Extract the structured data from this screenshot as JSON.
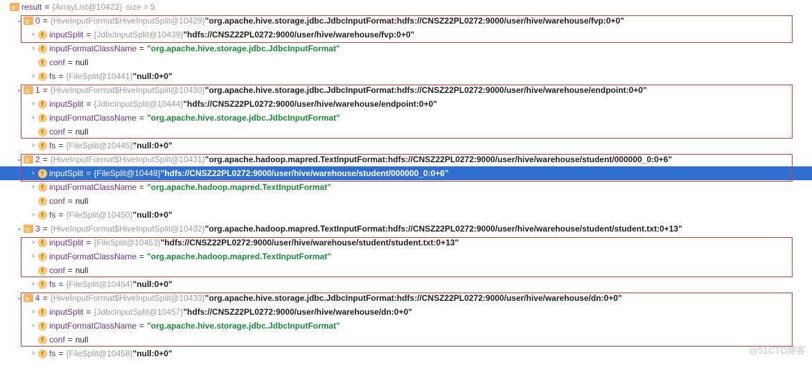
{
  "root": {
    "name": "result",
    "type": "{ArrayList@10422}",
    "size_label": "size = 5"
  },
  "items": [
    {
      "idx": "0",
      "type": "{HiveInputFormat$HiveInputSplit@10429}",
      "text": "\"org.apache.hive.storage.jdbc.JdbcInputFormat:hdfs://CNSZ22PL0272:9000/user/hive/warehouse/fvp:0+0\"",
      "inputSplit_type": "{JdbcInputSplit@10439}",
      "inputSplit_text": "\"hdfs://CNSZ22PL0272:9000/user/hive/warehouse/fvp:0+0\"",
      "inputFormatClassName": "\"org.apache.hive.storage.jdbc.JdbcInputFormat\"",
      "conf": "null",
      "fs_type": "{FileSplit@10441}",
      "fs_text": "\"null:0+0\""
    },
    {
      "idx": "1",
      "type": "{HiveInputFormat$HiveInputSplit@10430}",
      "text": "\"org.apache.hive.storage.jdbc.JdbcInputFormat:hdfs://CNSZ22PL0272:9000/user/hive/warehouse/endpoint:0+0\"",
      "inputSplit_type": "{JdbcInputSplit@10444}",
      "inputSplit_text": "\"hdfs://CNSZ22PL0272:9000/user/hive/warehouse/endpoint:0+0\"",
      "inputFormatClassName": "\"org.apache.hive.storage.jdbc.JdbcInputFormat\"",
      "conf": "null",
      "fs_type": "{FileSplit@10445}",
      "fs_text": "\"null:0+0\""
    },
    {
      "idx": "2",
      "type": "{HiveInputFormat$HiveInputSplit@10431}",
      "text": "\"org.apache.hadoop.mapred.TextInputFormat:hdfs://CNSZ22PL0272:9000/user/hive/warehouse/student/000000_0:0+6\"",
      "inputSplit_type": "{FileSplit@10448}",
      "inputSplit_text": "\"hdfs://CNSZ22PL0272:9000/user/hive/warehouse/student/000000_0:0+6\"",
      "inputFormatClassName": "\"org.apache.hadoop.mapred.TextInputFormat\"",
      "conf": "null",
      "fs_type": "{FileSplit@10450}",
      "fs_text": "\"null:0+0\""
    },
    {
      "idx": "3",
      "type": "{HiveInputFormat$HiveInputSplit@10432}",
      "text": "\"org.apache.hadoop.mapred.TextInputFormat:hdfs://CNSZ22PL0272:9000/user/hive/warehouse/student/student.txt:0+13\"",
      "inputSplit_type": "{FileSplit@10453}",
      "inputSplit_text": "\"hdfs://CNSZ22PL0272:9000/user/hive/warehouse/student/student.txt:0+13\"",
      "inputFormatClassName": "\"org.apache.hadoop.mapred.TextInputFormat\"",
      "conf": "null",
      "fs_type": "{FileSplit@10454}",
      "fs_text": "\"null:0+0\""
    },
    {
      "idx": "4",
      "type": "{HiveInputFormat$HiveInputSplit@10433}",
      "text": "\"org.apache.hive.storage.jdbc.JdbcInputFormat:hdfs://CNSZ22PL0272:9000/user/hive/warehouse/dn:0+0\"",
      "inputSplit_type": "{JdbcInputSplit@10457}",
      "inputSplit_text": "\"hdfs://CNSZ22PL0272:9000/user/hive/warehouse/dn:0+0\"",
      "inputFormatClassName": "\"org.apache.hive.storage.jdbc.JdbcInputFormat\"",
      "conf": "null",
      "fs_type": "{FileSplit@10458}",
      "fs_text": "\"null:0+0\""
    }
  ],
  "labels": {
    "inputSplit": "inputSplit",
    "inputFormatClassName": "inputFormatClassName",
    "conf": "conf",
    "fs": "fs"
  },
  "watermark": "@51CTO博客"
}
